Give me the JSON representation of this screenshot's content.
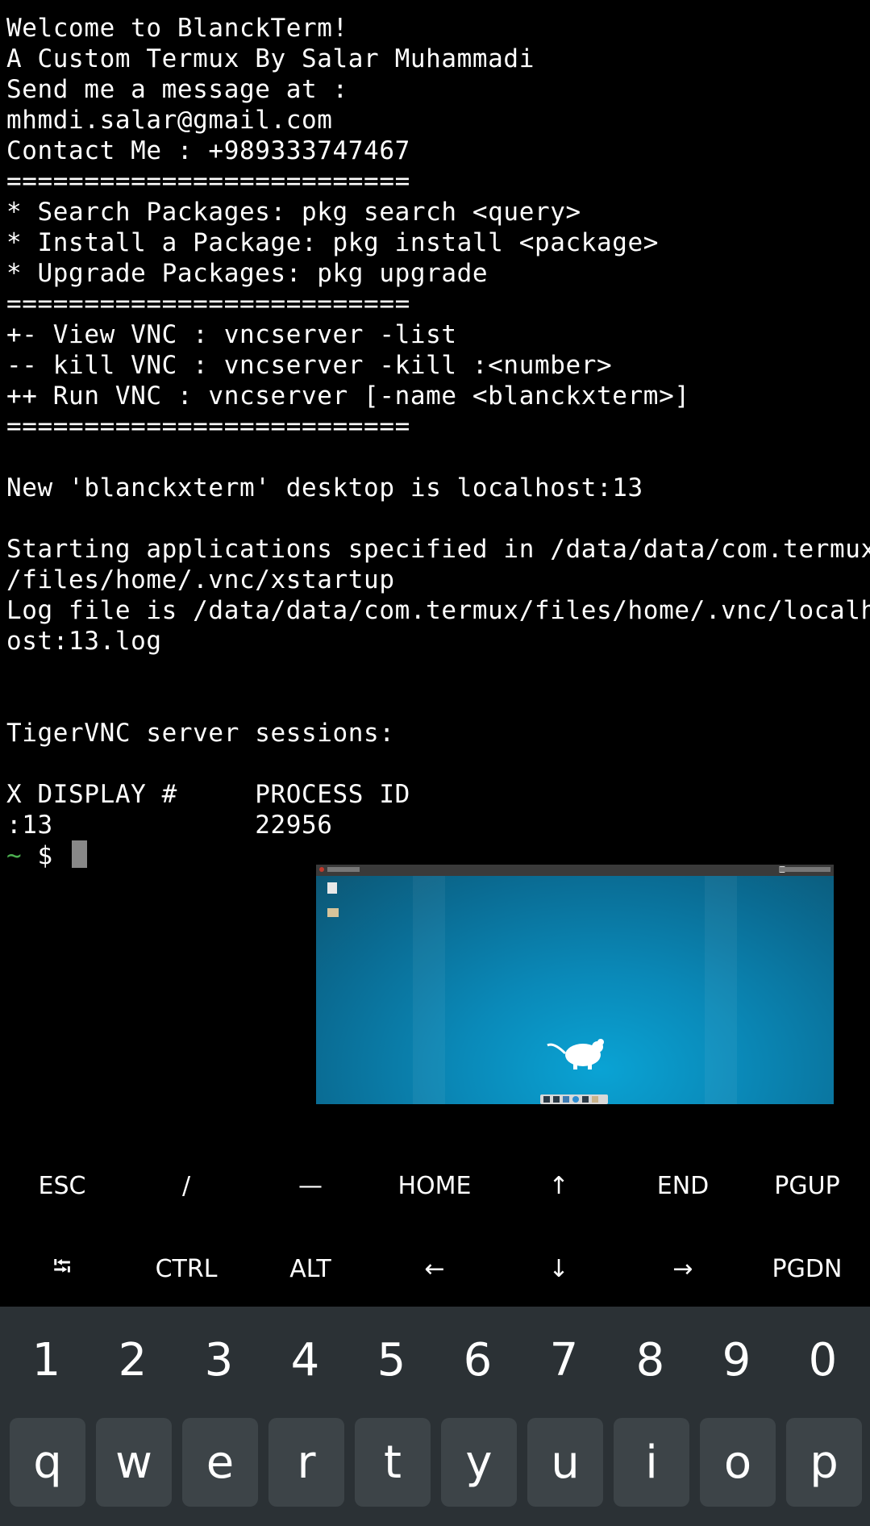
{
  "terminal": {
    "lines": [
      "Welcome to BlanckTerm!",
      "A Custom Termux By Salar Muhammadi",
      "Send me a message at :",
      "mhmdi.salar@gmail.com",
      "Contact Me : +989333747467",
      "==========================",
      "* Search Packages: pkg search <query>",
      "* Install a Package: pkg install <package>",
      "* Upgrade Packages: pkg upgrade",
      "==========================",
      "+- View VNC : vncserver -list",
      "-- kill VNC : vncserver -kill :<number>",
      "++ Run VNC : vncserver [-name <blanckxterm>]",
      "==========================",
      "",
      "New 'blanckxterm' desktop is localhost:13",
      "",
      "Starting applications specified in /data/data/com.termux",
      "/files/home/.vnc/xstartup",
      "Log file is /data/data/com.termux/files/home/.vnc/localh",
      "ost:13.log",
      "",
      "",
      "TigerVNC server sessions:",
      "",
      "X DISPLAY #     PROCESS ID",
      ":13             22956"
    ],
    "prompt": {
      "tilde": "~",
      "symbol": " $ "
    },
    "colors": {
      "text": "#ffffff",
      "prompt": "#4caf50",
      "background": "#000000"
    }
  },
  "vnc_preview": {
    "desktop_color": "#0a89b8",
    "mouse_icon": "xfce-mouse-icon"
  },
  "extra_keys": {
    "row1": [
      "ESC",
      "/",
      "—",
      "HOME",
      "↑",
      "END",
      "PGUP"
    ],
    "row2": [
      "⭾",
      "CTRL",
      "ALT",
      "←",
      "↓",
      "→",
      "PGDN"
    ]
  },
  "keyboard": {
    "numbers": [
      "1",
      "2",
      "3",
      "4",
      "5",
      "6",
      "7",
      "8",
      "9",
      "0"
    ],
    "letters": [
      "q",
      "w",
      "e",
      "r",
      "t",
      "y",
      "u",
      "i",
      "o",
      "p"
    ],
    "background": "#2b3135",
    "key_color": "#3d4448"
  }
}
